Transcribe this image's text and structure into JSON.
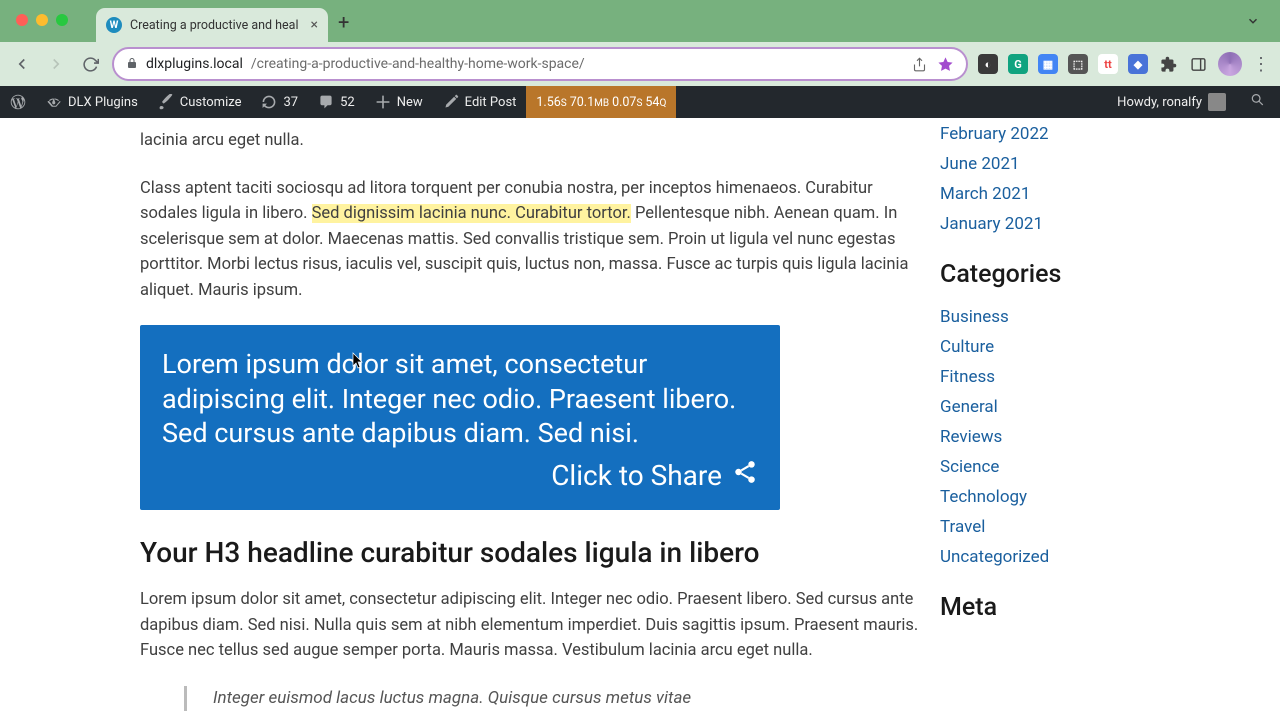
{
  "browser": {
    "tab_title": "Creating a productive and heal",
    "url_host": "dlxplugins.local",
    "url_path": "/creating-a-productive-and-healthy-home-work-space/"
  },
  "wp_bar": {
    "site_name": "DLX Plugins",
    "customize": "Customize",
    "updates": "37",
    "comments": "52",
    "new": "New",
    "edit": "Edit Post",
    "qm_time": "1.56",
    "qm_time_unit": "s",
    "qm_mem": "70.1",
    "qm_mem_unit": "MB",
    "qm_db": "0.07",
    "qm_db_unit": "s",
    "qm_q": "54",
    "qm_q_unit": "Q",
    "howdy": "Howdy, ronalfy"
  },
  "article": {
    "p0_tail": "lacinia arcu eget nulla.",
    "p1_a": "Class aptent taciti sociosqu ad litora torquent per conubia nostra, per inceptos himenaeos. Curabitur sodales ligula in libero. ",
    "p1_hl": "Sed dignissim lacinia nunc. Curabitur tortor.",
    "p1_b": " Pellentesque nibh. Aenean quam. In scelerisque sem at dolor. Maecenas mattis. Sed convallis tristique sem. Proin ut ligula vel nunc egestas porttitor. Morbi lectus risus, iaculis vel, suscipit quis, luctus non, massa. Fusce ac turpis quis ligula lacinia aliquet. Mauris ipsum.",
    "cts_text": "Lorem ipsum dolor sit amet, consectetur adipiscing elit. Integer nec odio. Praesent libero. Sed cursus ante dapibus diam. Sed nisi.",
    "cts_cta": "Click to Share",
    "h3": "Your H3 headline curabitur sodales ligula in libero",
    "p2": "Lorem ipsum dolor sit amet, consectetur adipiscing elit. Integer nec odio. Praesent libero. Sed cursus ante dapibus diam. Sed nisi. Nulla quis sem at nibh elementum imperdiet. Duis sagittis ipsum. Praesent mauris. Fusce nec tellus sed augue semper porta. Mauris massa. Vestibulum lacinia arcu eget nulla.",
    "bq": "Integer euismod lacus luctus magna. Quisque cursus metus vitae"
  },
  "sidebar": {
    "archives": [
      "February 2022",
      "June 2021",
      "March 2021",
      "January 2021"
    ],
    "cat_heading": "Categories",
    "categories": [
      "Business",
      "Culture",
      "Fitness",
      "General",
      "Reviews",
      "Science",
      "Technology",
      "Travel",
      "Uncategorized"
    ],
    "meta_heading": "Meta"
  }
}
